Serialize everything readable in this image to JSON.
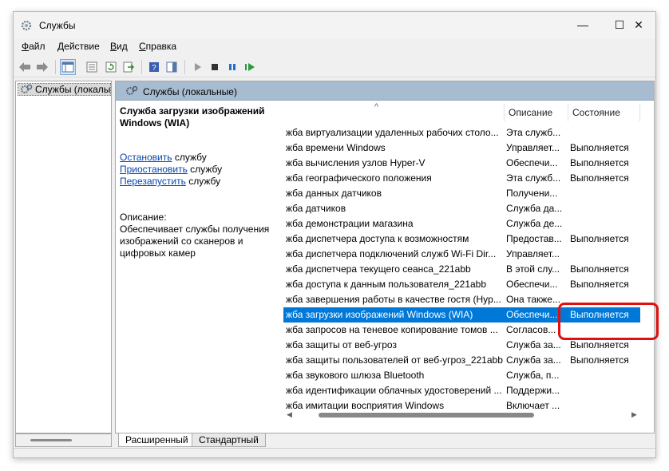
{
  "window": {
    "title": "Службы",
    "controls": {
      "minimize": "—",
      "maximize": "☐",
      "close": "✕"
    }
  },
  "menu": [
    {
      "label": "Файл",
      "u": "Ф",
      "rest": "айл"
    },
    {
      "label": "Действие",
      "u": "Д",
      "rest": "ействие"
    },
    {
      "label": "Вид",
      "u": "В",
      "rest": "ид"
    },
    {
      "label": "Справка",
      "u": "С",
      "rest": "правка"
    }
  ],
  "tree": {
    "selected_label": "Службы (локалы"
  },
  "pane": {
    "header_title": "Службы (локальные)",
    "service_title": "Служба загрузки изображений Windows (WIA)",
    "actions": [
      {
        "link": "Остановить",
        "suffix": " службу"
      },
      {
        "link": "Приостановить",
        "suffix": " службу"
      },
      {
        "link": "Перезапустить",
        "suffix": " службу"
      }
    ],
    "description_label": "Описание:",
    "description_text": "Обеспечивает службы получения изображений со сканеров и цифровых камер"
  },
  "list": {
    "sort_indicator": "^",
    "columns": {
      "description": "Описание",
      "status": "Состояние"
    },
    "rows": [
      {
        "name": "жба виртуализации удаленных рабочих столо...",
        "desc": "Эта служб...",
        "status": ""
      },
      {
        "name": "жба времени Windows",
        "desc": "Управляет...",
        "status": "Выполняется"
      },
      {
        "name": "жба вычисления узлов Hyper-V",
        "desc": "Обеспечи...",
        "status": "Выполняется"
      },
      {
        "name": "жба географического положения",
        "desc": "Эта служб...",
        "status": "Выполняется"
      },
      {
        "name": "жба данных датчиков",
        "desc": "Получени...",
        "status": ""
      },
      {
        "name": "жба датчиков",
        "desc": "Служба да...",
        "status": ""
      },
      {
        "name": "жба демонстрации магазина",
        "desc": "Служба де...",
        "status": ""
      },
      {
        "name": "жба диспетчера доступа к возможностям",
        "desc": "Предостав...",
        "status": "Выполняется"
      },
      {
        "name": "жба диспетчера подключений служб Wi-Fi Dir...",
        "desc": "Управляет...",
        "status": ""
      },
      {
        "name": "жба диспетчера текущего сеанса_221abb",
        "desc": "В этой слу...",
        "status": "Выполняется"
      },
      {
        "name": "жба доступа к данным пользователя_221abb",
        "desc": "Обеспечи...",
        "status": "Выполняется"
      },
      {
        "name": "жба завершения работы в качестве гостя (Hyp...",
        "desc": "Она также...",
        "status": ""
      },
      {
        "name": "жба загрузки изображений Windows (WIA)",
        "desc": "Обеспечи...",
        "status": "Выполняется",
        "selected": true
      },
      {
        "name": "жба запросов на теневое копирование томов ...",
        "desc": "Согласов...",
        "status": ""
      },
      {
        "name": "жба защиты от веб-угроз",
        "desc": "Служба за...",
        "status": "Выполняется"
      },
      {
        "name": "жба защиты пользователей от веб-угроз_221abb",
        "desc": "Служба за...",
        "status": "Выполняется"
      },
      {
        "name": "жба звукового шлюза Bluetooth",
        "desc": "Служба, п...",
        "status": ""
      },
      {
        "name": "жба идентификации облачных удостоверений ...",
        "desc": "Поддержи...",
        "status": ""
      },
      {
        "name": "жба имитации восприятия Windows",
        "desc": "Включает ...",
        "status": ""
      }
    ]
  },
  "tabs": [
    {
      "label": "Расширенный",
      "active": true
    },
    {
      "label": "Стандартный",
      "active": false
    }
  ],
  "colors": {
    "selection": "#0078d7",
    "header": "#a7bcd0",
    "highlight": "#e01010"
  }
}
